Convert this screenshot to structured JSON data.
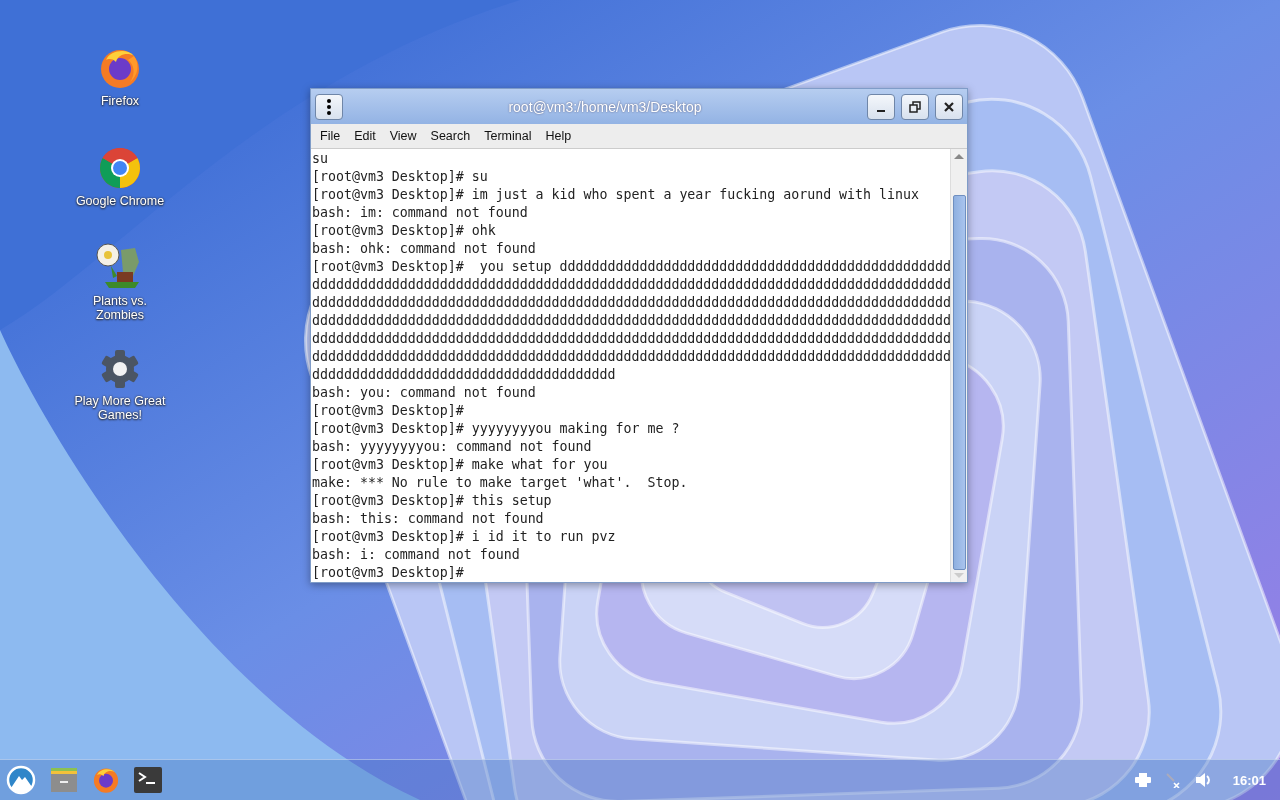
{
  "desktop_icons": [
    {
      "kind": "firefox",
      "label": "Firefox"
    },
    {
      "kind": "chrome",
      "label": "Google Chrome"
    },
    {
      "kind": "game",
      "label": "Plants vs. Zombies"
    },
    {
      "kind": "gear",
      "label": "Play More Great Games!"
    }
  ],
  "window": {
    "title": "root@vm3:/home/vm3/Desktop",
    "menu": [
      "File",
      "Edit",
      "View",
      "Search",
      "Terminal",
      "Help"
    ],
    "lines": [
      "su",
      "[root@vm3 Desktop]# su",
      "[root@vm3 Desktop]# im just a kid who spent a year fucking aorund with linux",
      "bash: im: command not found",
      "[root@vm3 Desktop]# ohk",
      "bash: ohk: command not found",
      "[root@vm3 Desktop]#  you setup ddddddddddddddddddddddddddddddddddddddddddddddddd",
      "dddddddddddddddddddddddddddddddddddddddddddddddddddddddddddddddddddddddddddddddd",
      "dddddddddddddddddddddddddddddddddddddddddddddddddddddddddddddddddddddddddddddddd",
      "dddddddddddddddddddddddddddddddddddddddddddddddddddddddddddddddddddddddddddddddd",
      "dddddddddddddddddddddddddddddddddddddddddddddddddddddddddddddddddddddddddddddddd",
      "dddddddddddddddddddddddddddddddddddddddddddddddddddddddddddddddddddddddddddddddd",
      "dddddddddddddddddddddddddddddddddddddd",
      "bash: you: command not found",
      "[root@vm3 Desktop]#",
      "[root@vm3 Desktop]# yyyyyyyyou making for me ?",
      "bash: yyyyyyyyou: command not found",
      "[root@vm3 Desktop]# make what for you",
      "make: *** No rule to make target 'what'.  Stop.",
      "[root@vm3 Desktop]# this setup",
      "bash: this: command not found",
      "[root@vm3 Desktop]# i id it to run pvz",
      "bash: i: command not found",
      "[root@vm3 Desktop]#"
    ]
  },
  "taskbar": {
    "clock": "16:01"
  }
}
